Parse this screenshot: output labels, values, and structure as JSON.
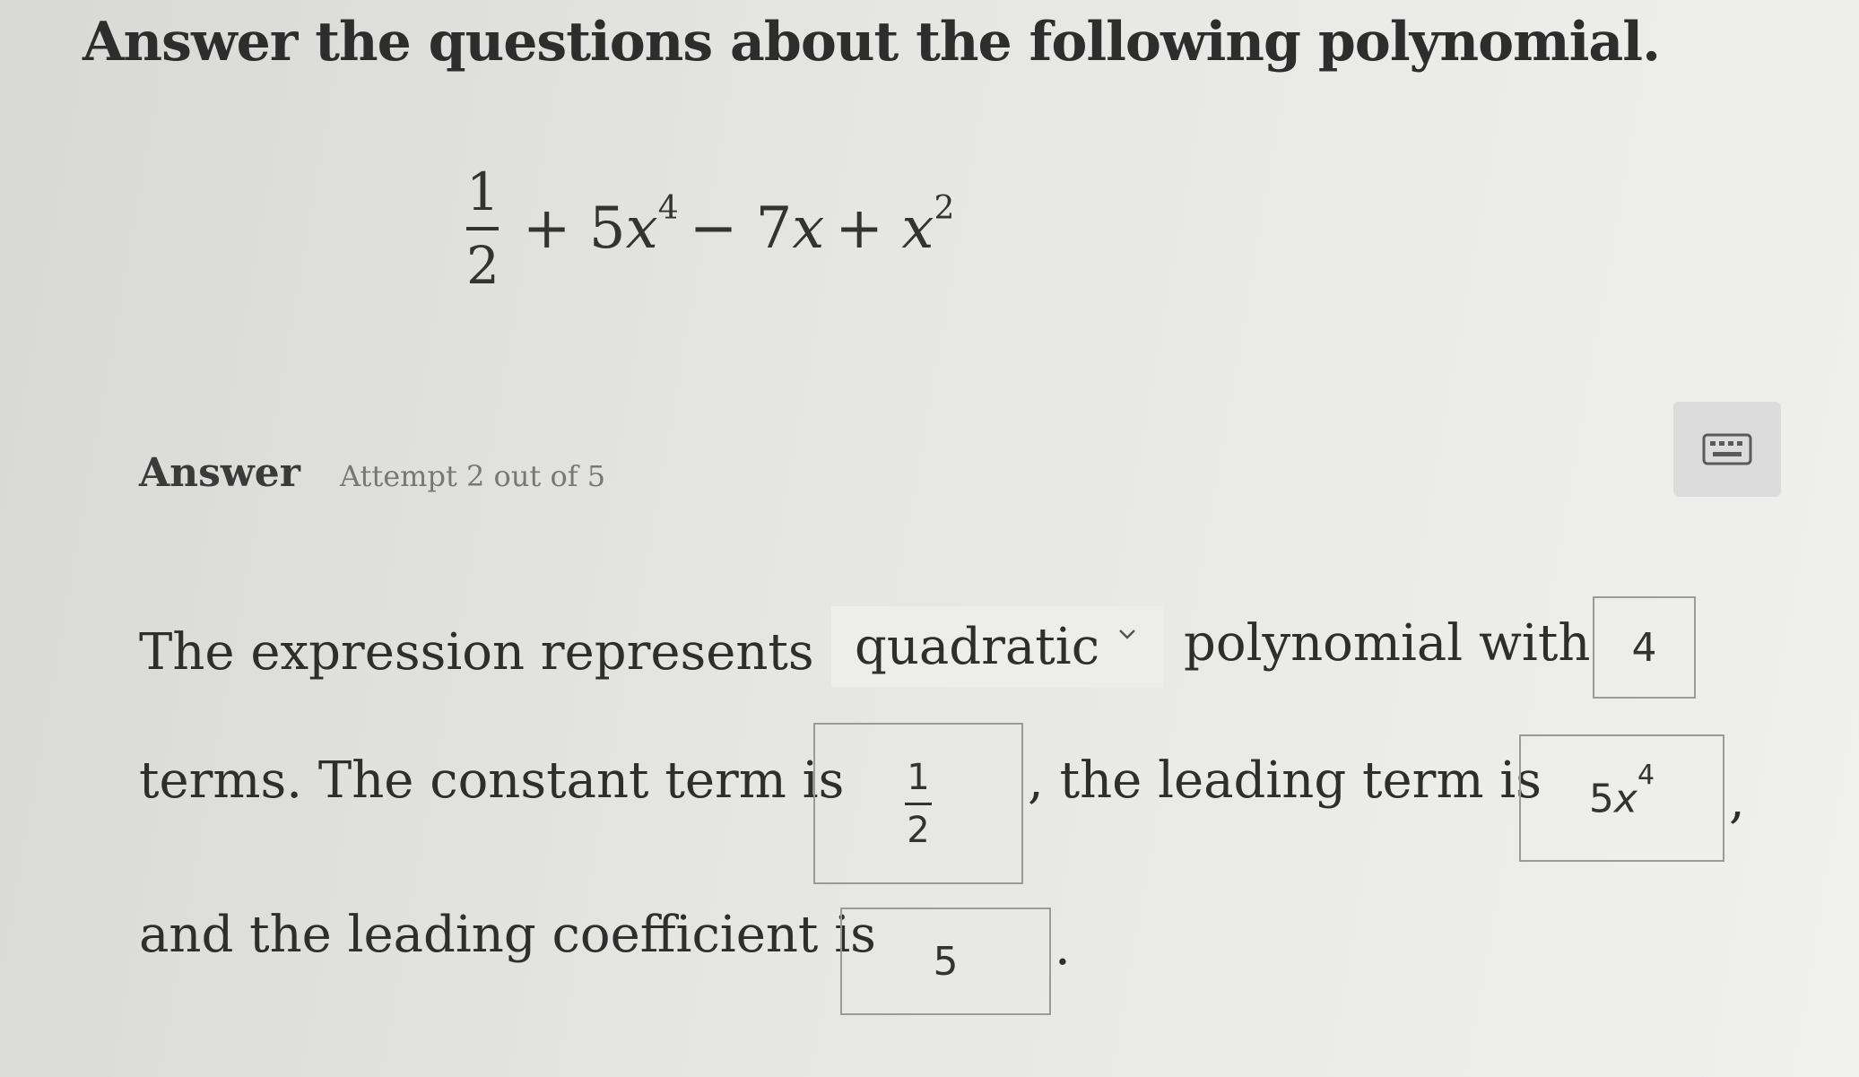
{
  "question": "Answer the questions about the following polynomial.",
  "polynomial": {
    "frac_num": "1",
    "frac_den": "2",
    "term2": "+ 5",
    "term2_var": "x",
    "term2_exp": "4",
    "term3": "− 7",
    "term3_var": "x",
    "term4": "+",
    "term4_var": "x",
    "term4_exp": "2"
  },
  "answer": {
    "label": "Answer",
    "attempt": "Attempt 2 out of 5"
  },
  "sentence": {
    "part1": "The expression represents a",
    "part2": "polynomial with",
    "part3": "terms. The constant term is",
    "part4": ", the leading term is",
    "part5": ",",
    "part6": "and the leading coefficient is",
    "part7": "."
  },
  "inputs": {
    "type_selected": "quadratic",
    "num_terms": "4",
    "constant_num": "1",
    "constant_den": "2",
    "leading_term_coef": "5",
    "leading_term_var": "x",
    "leading_term_exp": "4",
    "leading_coefficient": "5"
  }
}
